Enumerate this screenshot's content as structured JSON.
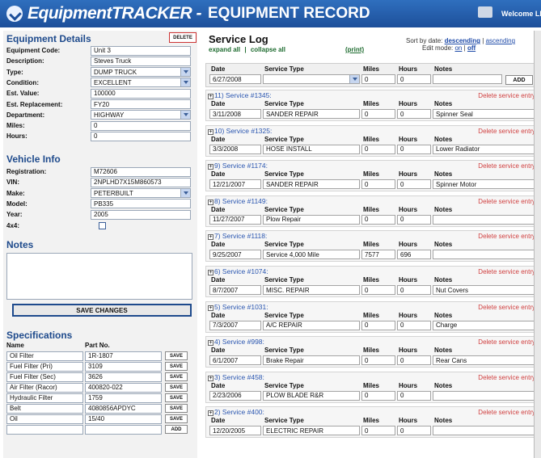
{
  "header": {
    "title_brand": "EquipmentTRACKER -",
    "title_page": "EQUIPMENT RECORD",
    "welcome": "Welcome LINK"
  },
  "details": {
    "heading": "Equipment Details",
    "delete_label": "DELETE",
    "fields": [
      {
        "label": "Equipment Code:",
        "value": "Unit 3",
        "type": "text"
      },
      {
        "label": "Description:",
        "value": "Steves Truck",
        "type": "text"
      },
      {
        "label": "Type:",
        "value": "DUMP TRUCK",
        "type": "select"
      },
      {
        "label": "Condition:",
        "value": "EXCELLENT",
        "type": "select"
      },
      {
        "label": "Est. Value:",
        "value": "100000",
        "type": "text"
      },
      {
        "label": "Est. Replacement:",
        "value": "FY20",
        "type": "text"
      },
      {
        "label": "Department:",
        "value": "HIGHWAY",
        "type": "select"
      },
      {
        "label": "Miles:",
        "value": "0",
        "type": "text"
      },
      {
        "label": "Hours:",
        "value": "0",
        "type": "text"
      }
    ]
  },
  "vehicle": {
    "heading": "Vehicle Info",
    "fields": [
      {
        "label": "Registration:",
        "value": "M72606",
        "type": "text"
      },
      {
        "label": "VIN:",
        "value": "2NPLHD7X15M860573",
        "type": "text"
      },
      {
        "label": "Make:",
        "value": "PETERBUILT",
        "type": "select"
      },
      {
        "label": "Model:",
        "value": "PB335",
        "type": "text"
      },
      {
        "label": "Year:",
        "value": "2005",
        "type": "text"
      },
      {
        "label": "4x4:",
        "value": "",
        "type": "checkbox"
      }
    ]
  },
  "notes": {
    "heading": "Notes",
    "value": ""
  },
  "save_changes": "SAVE CHANGES",
  "specs": {
    "heading": "Specifications",
    "col_name": "Name",
    "col_part": "Part No.",
    "save_label": "SAVE",
    "add_label": "ADD",
    "rows": [
      {
        "name": "Oil Filter",
        "part": "1R-1807"
      },
      {
        "name": "Fuel Filter (Pri)",
        "part": "3109"
      },
      {
        "name": "Fuel Filter (Sec)",
        "part": "3626"
      },
      {
        "name": "Air Filter (Racor)",
        "part": "400820-022"
      },
      {
        "name": "Hydraulic Filter",
        "part": "1759"
      },
      {
        "name": "Belt",
        "part": "4080856APDYC"
      },
      {
        "name": "Oil",
        "part": "15/40"
      }
    ]
  },
  "servicelog": {
    "heading": "Service Log",
    "expand": "expand all",
    "sep": "|",
    "collapse": "collapse all",
    "print": "(print)",
    "sort_prefix": "Sort by date:",
    "sort_desc": "descending",
    "sort_sep": "|",
    "sort_asc": "ascending",
    "edit_prefix": "Edit mode:",
    "edit_on": "on",
    "edit_sep": "|",
    "edit_off": "off",
    "col_date": "Date",
    "col_type": "Service Type",
    "col_miles": "Miles",
    "col_hours": "Hours",
    "col_notes": "Notes",
    "delete_label": "Delete service entry",
    "add_label": "ADD",
    "new_entry": {
      "date": "6/27/2008",
      "type": "",
      "miles": "0",
      "hours": "0",
      "notes": ""
    },
    "entries": [
      {
        "title": "11) Service #1345:",
        "date": "3/11/2008",
        "type": "SANDER REPAIR",
        "miles": "0",
        "hours": "0",
        "notes": "Spinner Seal"
      },
      {
        "title": "10) Service #1325:",
        "date": "3/3/2008",
        "type": "HOSE INSTALL",
        "miles": "0",
        "hours": "0",
        "notes": "Lower Radiator"
      },
      {
        "title": "9) Service #1174:",
        "date": "12/21/2007",
        "type": "SANDER REPAIR",
        "miles": "0",
        "hours": "0",
        "notes": "Spinner Motor"
      },
      {
        "title": "8) Service #1149:",
        "date": "11/27/2007",
        "type": "Plow Repair",
        "miles": "0",
        "hours": "0",
        "notes": ""
      },
      {
        "title": "7) Service #1118:",
        "date": "9/25/2007",
        "type": "Service 4,000 Mile",
        "miles": "7577",
        "hours": "696",
        "notes": ""
      },
      {
        "title": "6) Service #1074:",
        "date": "8/7/2007",
        "type": "MISC. REPAIR",
        "miles": "0",
        "hours": "0",
        "notes": "Nut Covers"
      },
      {
        "title": "5) Service #1031:",
        "date": "7/3/2007",
        "type": "A/C REPAIR",
        "miles": "0",
        "hours": "0",
        "notes": "Charge"
      },
      {
        "title": "4) Service #998:",
        "date": "6/1/2007",
        "type": "Brake Repair",
        "miles": "0",
        "hours": "0",
        "notes": "Rear Cans"
      },
      {
        "title": "3) Service #458:",
        "date": "2/23/2006",
        "type": "PLOW BLADE R&R",
        "miles": "0",
        "hours": "0",
        "notes": ""
      },
      {
        "title": "2) Service #400:",
        "date": "12/20/2005",
        "type": "ELECTRIC REPAIR",
        "miles": "0",
        "hours": "0",
        "notes": ""
      }
    ]
  }
}
